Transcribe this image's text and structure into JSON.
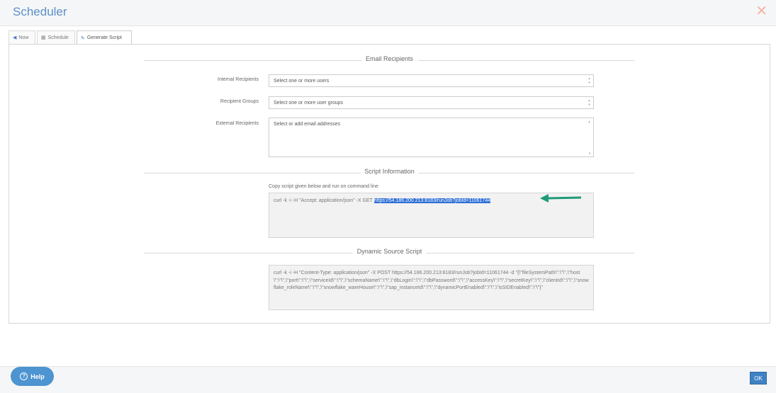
{
  "dialog": {
    "title": "Scheduler",
    "close_icon": "close-icon"
  },
  "tabs": [
    {
      "label": "Now",
      "icon": "send-icon"
    },
    {
      "label": "Schedule",
      "icon": "calendar-icon"
    },
    {
      "label": "Generate Script",
      "icon": "script-icon",
      "active": true
    }
  ],
  "email_recipients": {
    "section_title": "Email Recipients",
    "internal": {
      "label": "Internal Recipients",
      "placeholder": "Select one or more users"
    },
    "groups": {
      "label": "Recipient Groups",
      "placeholder": "Select one or more user groups"
    },
    "external": {
      "label": "External Recipients",
      "placeholder": "Select or add email addresses"
    }
  },
  "script_information": {
    "section_title": "Script Information",
    "hint": "Copy script given below and run on command line",
    "command_prefix": "curl -k -i -H \"Accept: application/json\" -X GET ",
    "command_url": "https://54.186.200.213:8183/runJob?jobId=11061744"
  },
  "dynamic_source_script": {
    "section_title": "Dynamic Source Script",
    "script": "curl -k -i -H \"Content-Type: application/json\" -X POST https://54.186.200.213:8183/runJob?jobId=11061744 -d \"{\\\"fileSystemPath\\\":\\\"\\\",\\\"host\\\":\\\"\\\",\\\"port\\\":\\\"\\\",\\\"serviceId\\\":\\\"\\\",\\\"schemaName\\\":\\\"\\\",\\\"dbLogin\\\":\\\"\\\",\\\"dbPassword\\\":\\\"\\\",\\\"accessKey\\\":\\\"\\\",\\\"secretKey\\\":\\\"\\\",\\\"clientId\\\":\\\"\\\",\\\"snowflake_roleName\\\":\\\"\\\",\\\"snowflake_wareHouse\\\":\\\"\\\",\\\"sap_instanceId\\\":\\\"\\\",\\\"dynamicPortEnabled\\\":\\\"\\\",\\\"isSIDEnabled\\\":\\\"\\\"}\""
  },
  "footer": {
    "help_label": "Help",
    "ok_label": "OK"
  },
  "colors": {
    "accent": "#4d94d0",
    "title": "#5b8fc7",
    "highlight": "#2f6fd6",
    "arrow": "#1f9a7a"
  }
}
